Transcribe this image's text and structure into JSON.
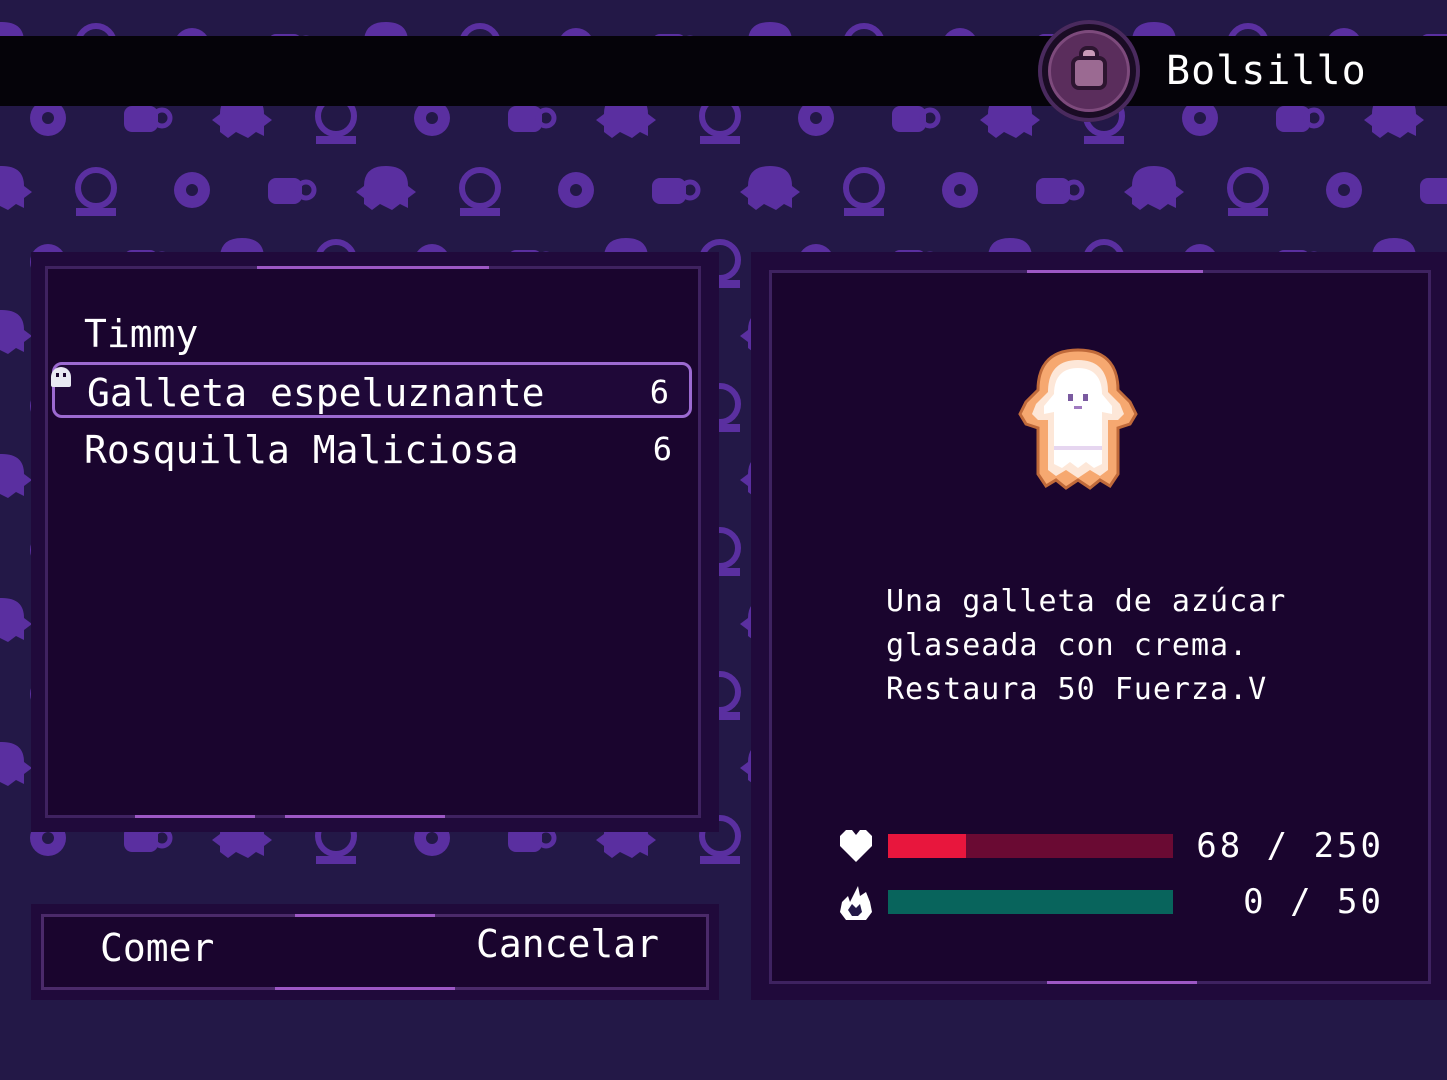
{
  "header": {
    "title": "Bolsillo",
    "icon": "bag-icon"
  },
  "inventory": {
    "character": "Timmy",
    "items": [
      {
        "name": "Galleta espeluznante",
        "qty": "6",
        "selected": true
      },
      {
        "name": "Rosquilla Maliciosa",
        "qty": "6",
        "selected": false
      }
    ]
  },
  "actions": {
    "use_label": "Comer",
    "cancel_label": "Cancelar"
  },
  "detail": {
    "item_icon": "ghost-cookie-icon",
    "description": "Una galleta de azúcar\nglaseada con crema.\nRestaura 50 Fuerza.V"
  },
  "stats": {
    "hp": {
      "icon": "heart-icon",
      "current": 68,
      "max": 250,
      "text": "68 / 250",
      "color": "#e8163d",
      "track": "#6a0a33"
    },
    "will": {
      "icon": "fire-icon",
      "current": 0,
      "max": 50,
      "text": "0 /  50",
      "color": "#2be0a6",
      "track": "#08645c"
    }
  },
  "colors": {
    "background": "#231847",
    "pattern": "#5a2fa0",
    "panel": "#1a052e",
    "accent": "#9d58c5"
  }
}
